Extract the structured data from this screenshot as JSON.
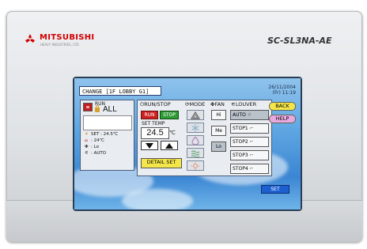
{
  "device": {
    "brand": "MITSUBISHI",
    "brand_sub": "HEAVY INDUSTRIES, LTD.",
    "model": "SC-SL3NA-AE"
  },
  "screen": {
    "title": "CHANGE [1F LOBBY G1]",
    "date": "26/11/2004",
    "time": "(Fr) 11:19",
    "left": {
      "run_label": "RUN",
      "group": "ALL",
      "set_temp": "SET : 24.5℃",
      "room_temp": ": 24℃",
      "fan": ": Lo",
      "louver": ": AUTO"
    },
    "controls": {
      "run_stop_header": "RUN/STOP",
      "mode_header": "MODE",
      "fan_header": "FAN",
      "louver_header": "LOUVER",
      "run_button": "RUN",
      "stop_button": "STOP",
      "set_temp_label": "SET TEMP",
      "set_temp_value": "24.5",
      "temp_unit": "℃",
      "detail_set": "DETAIL SET",
      "fan_speeds": [
        "Hi",
        "Me",
        "Lo"
      ],
      "fan_selected": "Lo",
      "louver_options": [
        "AUTO",
        "STOP1",
        "STOP2",
        "STOP3",
        "STOP4"
      ],
      "louver_selected": "AUTO",
      "modes": [
        "auto",
        "cool",
        "dry",
        "fan",
        "heat"
      ]
    },
    "side_buttons": {
      "back": "BACK",
      "help": "HELP",
      "set": "SET"
    }
  },
  "colors": {
    "run": "#cc2222",
    "stop": "#2e9b35",
    "detail": "#f4e64a",
    "help": "#e8a9e0",
    "set": "#1e5fd0",
    "brand": "#d40000"
  }
}
